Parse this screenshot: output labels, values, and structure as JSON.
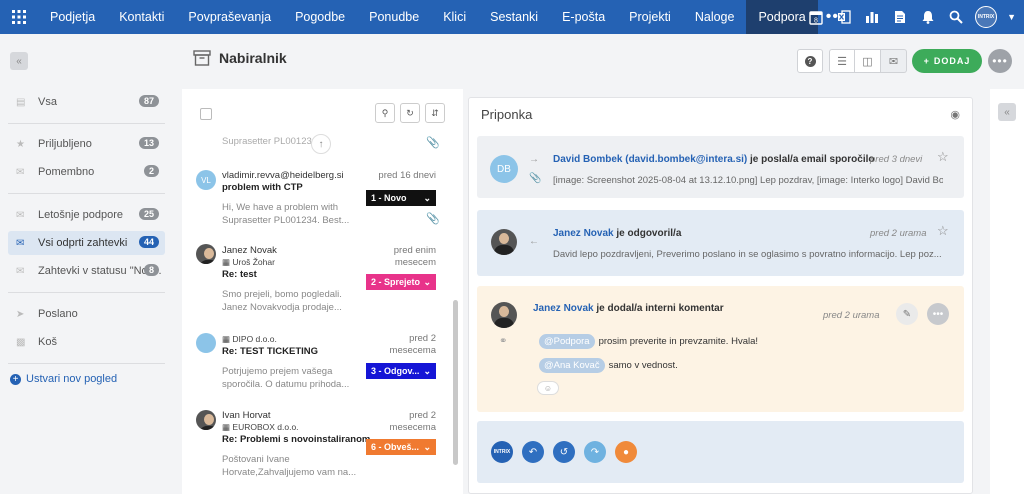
{
  "nav": {
    "items": [
      "Podjetja",
      "Kontakti",
      "Povpraševanja",
      "Pogodbe",
      "Ponudbe",
      "Klici",
      "Sestanki",
      "E-pošta",
      "Projekti",
      "Naloge",
      "Podpora"
    ],
    "active": "Podpora",
    "more": "•••",
    "calendar_day": "8",
    "avatar_text": "INTRIX"
  },
  "sidebar": {
    "items": [
      {
        "label": "Vsa",
        "count": "87"
      },
      {
        "label": "Priljubljeno",
        "count": "13"
      },
      {
        "label": "Pomembno",
        "count": "2"
      },
      {
        "label": "Letošnje podpore",
        "count": "25"
      },
      {
        "label": "Vsi odprti zahtevki",
        "count": "44"
      },
      {
        "label": "Zahtevki v statusu \"Nov...",
        "count": "8"
      },
      {
        "label": "Poslano"
      },
      {
        "label": "Koš"
      }
    ],
    "new_view": "Ustvari nov pogled"
  },
  "header": {
    "title": "Nabiralnik"
  },
  "toolbar": {
    "add_label": "DODAJ"
  },
  "list": {
    "truncated_top": "Suprasetter PL001234...",
    "mails": [
      {
        "avatar": "VL",
        "from": "vladimir.revva@heidelberg.si",
        "subject": "problem with CTP",
        "preview": "Hi, We have a problem with Suprasetter PL001234. Best...",
        "when": "pred 16 dnevi",
        "badge": "1 - Novo"
      },
      {
        "from": "Janez Novak",
        "org": "Uroš Žohar",
        "subject": "Re: test",
        "preview": "Smo prejeli, bomo pogledali. Janez Novakvodja prodaje...",
        "when": "pred enim mesecem",
        "badge": "2 - Sprejeto"
      },
      {
        "org": "DIPO d.o.o.",
        "subject": "Re: TEST TICKETING",
        "preview": "Potrjujemo prejem vašega sporočila. O datumu prihoda...",
        "when": "pred 2 mesecema",
        "badge": "3 - Odgov..."
      },
      {
        "from": "Ivan Horvat",
        "org": "EUROBOX d.o.o.",
        "subject": "Re: Problemi s novoinstaliranom...",
        "preview": "Poštovani Ivane Horvate,Zahvaljujemo vam na...",
        "when": "pred 2 mesecema",
        "badge": "6 - Obveš..."
      }
    ]
  },
  "detail": {
    "title": "Priponka",
    "entries": [
      {
        "avatar": "DB",
        "actor": "David Bombek (david.bombek@intera.si)",
        "action": "je poslal/a email sporočilo",
        "snippet": "[image: Screenshot 2025-08-04 at 13.12.10.png] Lep pozdrav, [image: Interko logo] David Bo...",
        "when": "pred 3 dnevi"
      },
      {
        "actor": "Janez Novak",
        "action": "je odgovoril/a",
        "snippet": "David lepo pozdravljeni, Preverimo poslano in se oglasimo s povratno informacijo. Lep poz...",
        "when": "pred 2 urama"
      },
      {
        "actor": "Janez Novak",
        "action": "je dodal/a interni komentar",
        "when": "pred 2 urama",
        "comment": [
          {
            "mention": "@Podpora",
            "text": "prosim preverite in prevzamite. Hvala!"
          },
          {
            "mention": "@Ana Kovač",
            "text": "samo v vednost."
          }
        ]
      }
    ],
    "action_avatar_text": "INTRIX"
  },
  "colors": {
    "nav": "#2562b4",
    "nav_active": "#1e3f6e",
    "add": "#3dab5a",
    "badge1": "#111111",
    "badge2": "#e8338a",
    "badge3": "#1515d6",
    "badge6": "#f07a30"
  }
}
